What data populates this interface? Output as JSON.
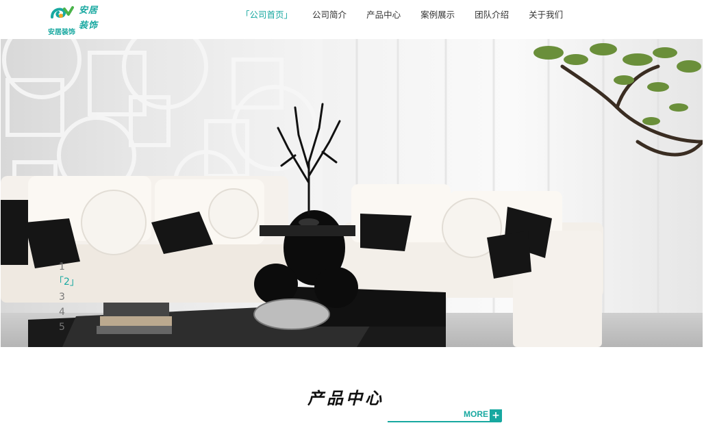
{
  "logo": {
    "line1": "安居",
    "line2": "装饰",
    "sub": "安居装饰",
    "icon": "logo-mark-icon"
  },
  "nav": {
    "items": [
      {
        "label": "公司首页",
        "active": true
      },
      {
        "label": "公司简介",
        "active": false
      },
      {
        "label": "产品中心",
        "active": false
      },
      {
        "label": "案例展示",
        "active": false
      },
      {
        "label": "团队介绍",
        "active": false
      },
      {
        "label": "关于我们",
        "active": false
      }
    ],
    "bracket_open": "「",
    "bracket_close": "」"
  },
  "banner": {
    "dots": [
      "1",
      "2",
      "3",
      "4",
      "5"
    ],
    "active_dot": "2"
  },
  "products": {
    "title": "产品中心",
    "more_label": "MORE",
    "more_plus": "+"
  },
  "colors": {
    "accent": "#17a8a0"
  }
}
